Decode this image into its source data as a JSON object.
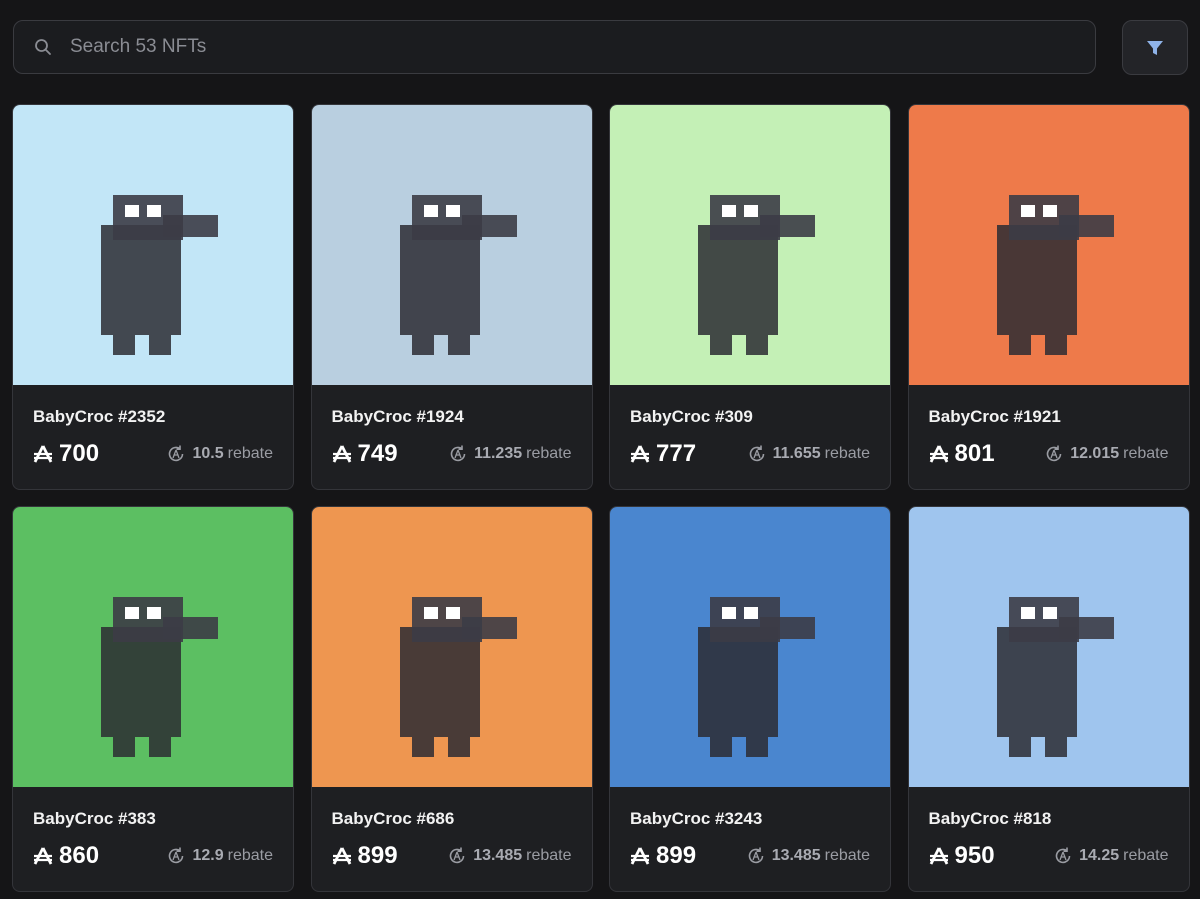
{
  "search": {
    "placeholder": "Search 53 NFTs",
    "value": ""
  },
  "colors": {
    "background": "#151517",
    "card": "#1e1f22",
    "border": "#34353a",
    "muted": "#9a9ca3"
  },
  "icons": {
    "search": "magnifier",
    "filter": "funnel",
    "price": "aptos-a",
    "rebate": "refresh-coin"
  },
  "rebate_label": "rebate",
  "items": [
    {
      "name": "BabyCroc #2352",
      "price": "700",
      "rebate": "10.5",
      "bg": "#c2e6f7"
    },
    {
      "name": "BabyCroc #1924",
      "price": "749",
      "rebate": "11.235",
      "bg": "#b9cfe0"
    },
    {
      "name": "BabyCroc #309",
      "price": "777",
      "rebate": "11.655",
      "bg": "#c4f0b6"
    },
    {
      "name": "BabyCroc #1921",
      "price": "801",
      "rebate": "12.015",
      "bg": "#ee7a4a"
    },
    {
      "name": "BabyCroc #383",
      "price": "860",
      "rebate": "12.9",
      "bg": "#5cbf62"
    },
    {
      "name": "BabyCroc #686",
      "price": "899",
      "rebate": "13.485",
      "bg": "#ee9650"
    },
    {
      "name": "BabyCroc #3243",
      "price": "899",
      "rebate": "13.485",
      "bg": "#4a86cf"
    },
    {
      "name": "BabyCroc #818",
      "price": "950",
      "rebate": "14.25",
      "bg": "#9fc5ee"
    }
  ]
}
